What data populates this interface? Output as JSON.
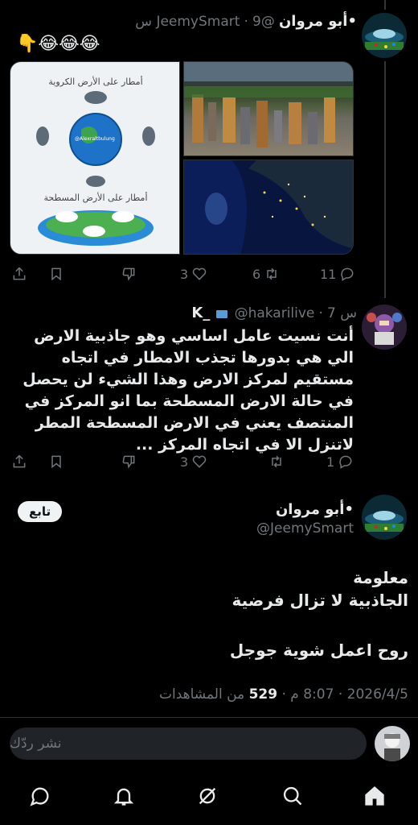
{
  "tweets": [
    {
      "name": "•أبو مروان",
      "handle": "@JeemySmart",
      "time": "9 س",
      "emoji": "👇😂😂😂",
      "image_labels": {
        "round_earth": "أمطار على الأرض الكروية",
        "flat_earth": "أمطار على الأرض المسطحة",
        "watermark": "@Alexraltbulung"
      },
      "actions": {
        "replies": "11",
        "retweets": "6",
        "likes": "3"
      }
    },
    {
      "name": "K_",
      "handle": "@hakarilive",
      "time": "7 س",
      "text": "أنت نسيت عامل اساسي وهو جاذبية الارض الي هي بدورها تجذب الامطار في اتجاه مستقيم لمركز الارض وهذا الشيء لن يحصل في حالة الارض المسطحة بما انو المركز في المنتصف يعني في الارض المسطحة المطر لاتنزل الا في اتجاه المركز ...",
      "actions": {
        "replies": "1",
        "retweets": "",
        "likes": "3"
      }
    }
  ],
  "main_tweet": {
    "name": "•أبو مروان",
    "handle": "@JeemySmart",
    "follow_label": "تابع",
    "text_line1": "معلومة",
    "text_line2": "الجاذبية لا تزال فرضية",
    "text_line3": "روح اعمل شوية جوجل",
    "date": "2026/4/5",
    "time": "8:07 م",
    "views_count": "529",
    "views_label": "من المشاهدات"
  },
  "reply": {
    "placeholder": "نشر ردّك"
  },
  "nav": [
    "home-icon",
    "grok-icon",
    "search-icon",
    "notifications-icon",
    "messages-icon"
  ],
  "colors": {
    "background": "#000000",
    "text": "#e7e9ea",
    "muted": "#71767b",
    "divider": "#2f3336"
  }
}
